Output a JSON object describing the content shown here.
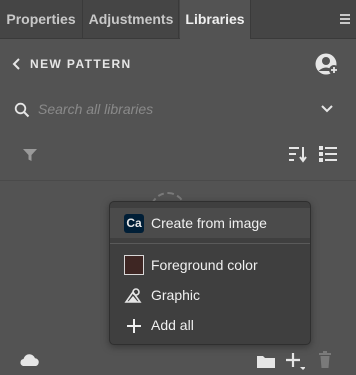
{
  "tabs": [
    {
      "label": "Properties"
    },
    {
      "label": "Adjustments"
    },
    {
      "label": "Libraries"
    }
  ],
  "header": {
    "title": "NEW PATTERN"
  },
  "search": {
    "placeholder": "Search all libraries"
  },
  "popup": {
    "badge_text": "Ca",
    "items": [
      {
        "label": "Create from image",
        "icon": "ca-badge-icon"
      },
      {
        "label": "Foreground color",
        "icon": "color-swatch-icon"
      },
      {
        "label": "Graphic",
        "icon": "graphic-icon"
      },
      {
        "label": "Add all",
        "icon": "plus-icon"
      }
    ]
  },
  "colors": {
    "panel_bg": "#535353",
    "tab_bg": "#454545",
    "popup_bg": "#3f3f3f",
    "foreground_swatch": "#3e2623",
    "ca_badge_bg": "#001e36"
  },
  "icons": {
    "menu": "hamburger-icon",
    "back": "chevron-left-icon",
    "user": "user-add-icon",
    "search": "search-icon",
    "dropdown": "chevron-down-icon",
    "filter": "filter-icon",
    "sort": "sort-icon",
    "view": "list-view-icon",
    "cloud": "cloud-icon",
    "folder": "folder-icon",
    "add": "plus-icon",
    "trash": "trash-icon"
  }
}
